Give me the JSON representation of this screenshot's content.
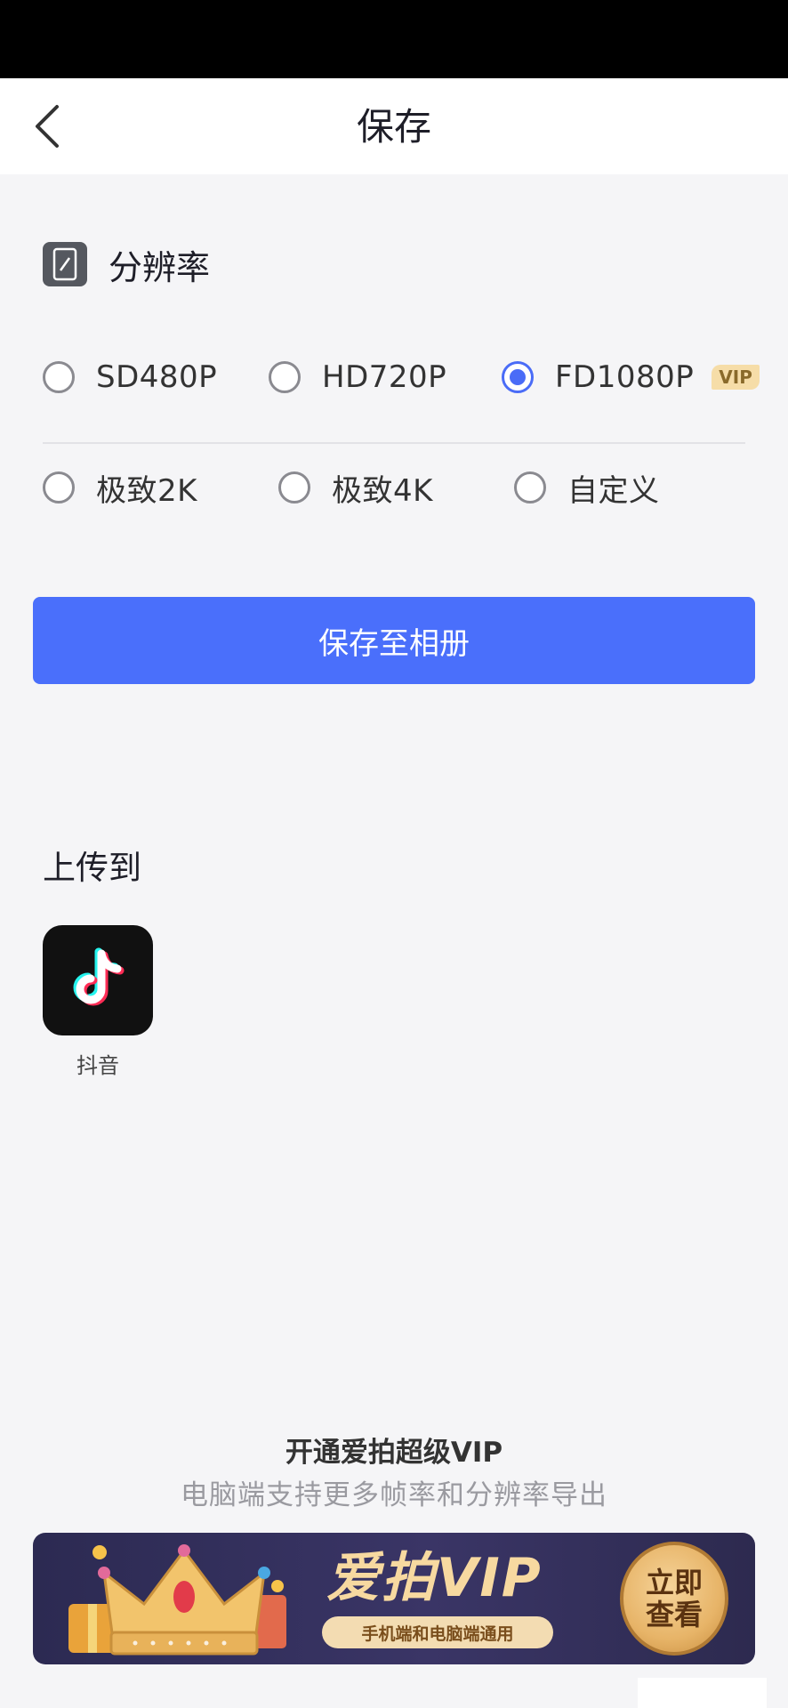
{
  "header": {
    "title": "保存"
  },
  "resolution": {
    "label": "分辨率",
    "options_row1": [
      {
        "label": "SD480P",
        "checked": false
      },
      {
        "label": "HD720P",
        "checked": false
      },
      {
        "label": "FD1080P",
        "checked": true,
        "badge": "VIP"
      }
    ],
    "options_row2": [
      {
        "label": "极致2K",
        "checked": false
      },
      {
        "label": "极致4K",
        "checked": false
      },
      {
        "label": "自定义",
        "checked": false
      }
    ]
  },
  "save_button": {
    "label": "保存至相册"
  },
  "upload": {
    "title": "上传到",
    "apps": [
      {
        "name": "抖音",
        "icon": "douyin-icon"
      }
    ]
  },
  "promo": {
    "title": "开通爱拍超级VIP",
    "subtitle": "电脑端支持更多帧率和分辨率导出"
  },
  "banner": {
    "brand": "爱拍VIP",
    "tagline": "手机端和电脑端通用",
    "cta": "立即查看"
  },
  "colors": {
    "accent": "#4a6ffb",
    "vip_gold": "#f6dda8",
    "background": "#f5f5f7"
  }
}
